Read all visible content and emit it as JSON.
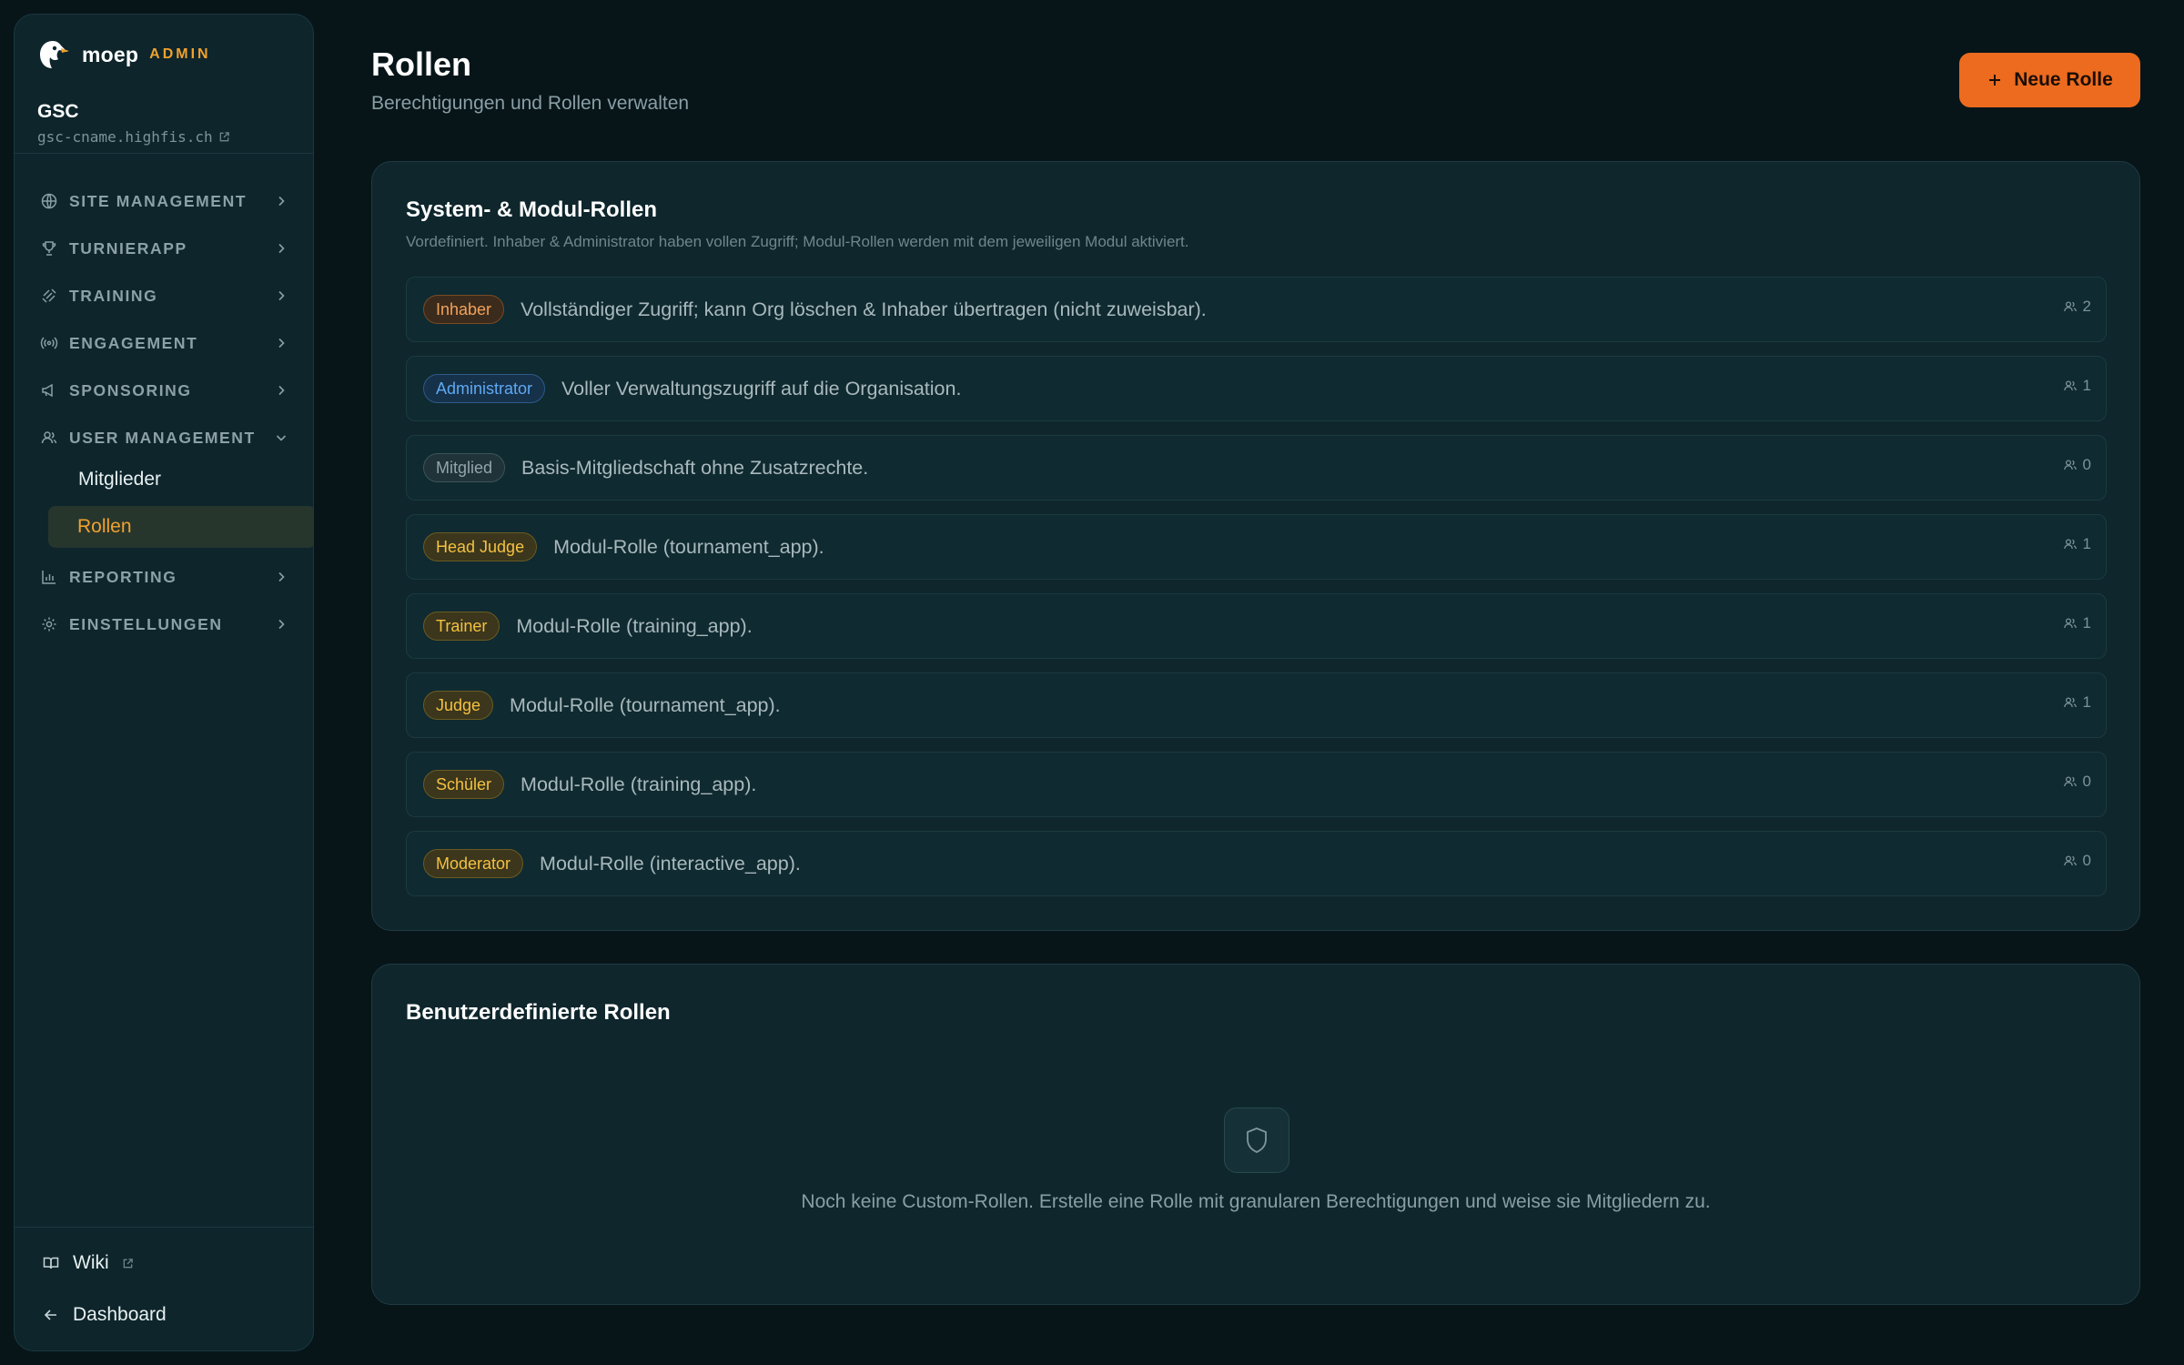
{
  "brand": {
    "name": "moep",
    "tag": "ADMIN"
  },
  "org": {
    "name": "GSC",
    "domain": "gsc-cname.highfis.ch"
  },
  "nav": [
    {
      "label": "SITE MANAGEMENT",
      "icon": "globe-icon"
    },
    {
      "label": "TURNIERAPP",
      "icon": "trophy-icon"
    },
    {
      "label": "TRAINING",
      "icon": "dumbbell-icon"
    },
    {
      "label": "ENGAGEMENT",
      "icon": "broadcast-icon"
    },
    {
      "label": "SPONSORING",
      "icon": "megaphone-icon"
    },
    {
      "label": "USER MANAGEMENT",
      "icon": "users-icon",
      "expanded": true,
      "children": [
        {
          "label": "Mitglieder"
        },
        {
          "label": "Rollen",
          "active": true
        }
      ]
    },
    {
      "label": "REPORTING",
      "icon": "bar-chart-icon"
    },
    {
      "label": "EINSTELLUNGEN",
      "icon": "gear-icon"
    }
  ],
  "footer": {
    "wiki": "Wiki",
    "dashboard": "Dashboard"
  },
  "header": {
    "title": "Rollen",
    "subtitle": "Berechtigungen und Rollen verwalten",
    "new_role_label": "Neue Rolle"
  },
  "system_roles": {
    "title": "System- & Modul-Rollen",
    "description": "Vordefiniert. Inhaber & Administrator haben vollen Zugriff; Modul-Rollen werden mit dem jeweiligen Modul aktiviert.",
    "roles": [
      {
        "badge": "Inhaber",
        "color": "orange",
        "description": "Vollständiger Zugriff; kann Org löschen & Inhaber übertragen (nicht zuweisbar).",
        "count": "2"
      },
      {
        "badge": "Administrator",
        "color": "blue",
        "description": "Voller Verwaltungszugriff auf die Organisation.",
        "count": "1"
      },
      {
        "badge": "Mitglied",
        "color": "gray",
        "description": "Basis-Mitgliedschaft ohne Zusatzrechte.",
        "count": "0"
      },
      {
        "badge": "Head Judge",
        "color": "yellow",
        "description": "Modul-Rolle (tournament_app).",
        "count": "1"
      },
      {
        "badge": "Trainer",
        "color": "yellow",
        "description": "Modul-Rolle (training_app).",
        "count": "1"
      },
      {
        "badge": "Judge",
        "color": "yellow",
        "description": "Modul-Rolle (tournament_app).",
        "count": "1"
      },
      {
        "badge": "Schüler",
        "color": "yellow",
        "description": "Modul-Rolle (training_app).",
        "count": "0"
      },
      {
        "badge": "Moderator",
        "color": "yellow",
        "description": "Modul-Rolle (interactive_app).",
        "count": "0"
      }
    ]
  },
  "custom_roles": {
    "title": "Benutzerdefinierte Rollen",
    "empty_text": "Noch keine Custom-Rollen. Erstelle eine Rolle mit granularen Berechtigungen und weise sie Mitgliedern zu."
  },
  "colors": {
    "accent": "#ec6b1f",
    "active_nav": "#f0a12e",
    "background": "#071519",
    "card": "#0e262c"
  }
}
